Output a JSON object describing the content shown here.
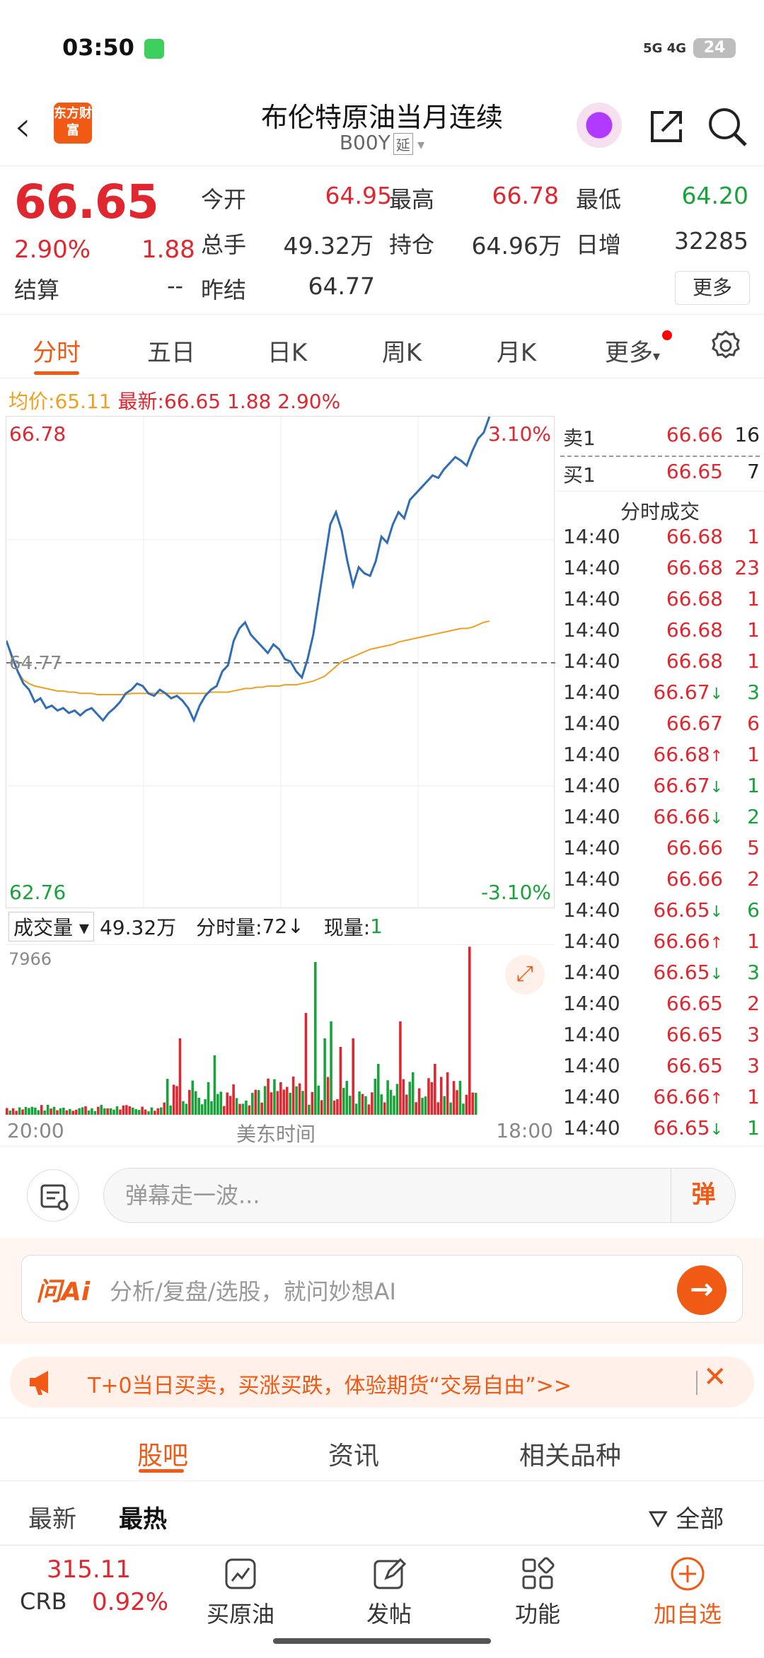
{
  "status": {
    "time": "03:50",
    "signal": "5G 4G",
    "battery": "24"
  },
  "header": {
    "back": "‹",
    "logo_text": "东方财富",
    "title": "布伦特原油当月连续",
    "code": "B00Y",
    "code_tag": "延"
  },
  "quote": {
    "price": "66.65",
    "pct": "2.90%",
    "change": "1.88",
    "settle_label": "结算",
    "settle_value": "--",
    "open_label": "今开",
    "open_value": "64.95",
    "high_label": "最高",
    "high_value": "66.78",
    "low_label": "最低",
    "low_value": "64.20",
    "vol_label": "总手",
    "vol_value": "49.32万",
    "oi_label": "持仓",
    "oi_value": "64.96万",
    "inc_label": "日增",
    "inc_value": "32285",
    "prev_label": "昨结",
    "prev_value": "64.77",
    "more": "更多"
  },
  "tabs": [
    "分时",
    "五日",
    "日K",
    "周K",
    "月K",
    "更多"
  ],
  "avg_line": {
    "avg_label": "均价:",
    "avg_value": "65.11",
    "last_label": "最新:",
    "last_value": "66.65",
    "chg": "1.88",
    "pct": "2.90%"
  },
  "chart_data": {
    "type": "line",
    "title": "",
    "ylim": [
      62.76,
      66.78
    ],
    "ref": 64.77,
    "y_top_label": "66.78",
    "y_bottom_label": "62.76",
    "pct_top": "3.10%",
    "pct_bottom": "-3.10%",
    "ref_label": "64.77",
    "x_start": "20:00",
    "x_mid": "美东时间",
    "x_end": "18:00",
    "price_series": [
      64.95,
      64.82,
      64.7,
      64.6,
      64.55,
      64.45,
      64.48,
      64.4,
      64.42,
      64.38,
      64.4,
      64.36,
      64.38,
      64.34,
      64.38,
      64.4,
      64.35,
      64.3,
      64.36,
      64.4,
      64.45,
      64.52,
      64.55,
      64.6,
      64.58,
      64.52,
      64.5,
      64.55,
      64.52,
      64.48,
      64.5,
      64.46,
      64.4,
      64.3,
      64.42,
      64.5,
      64.55,
      64.58,
      64.7,
      64.75,
      64.95,
      65.05,
      65.1,
      65.0,
      64.95,
      64.9,
      64.85,
      64.92,
      64.88,
      64.8,
      64.78,
      64.7,
      64.65,
      64.8,
      65.0,
      65.3,
      65.6,
      65.9,
      66.0,
      65.85,
      65.6,
      65.4,
      65.55,
      65.5,
      65.48,
      65.6,
      65.8,
      65.75,
      65.9,
      66.0,
      65.95,
      66.1,
      66.15,
      66.2,
      66.25,
      66.3,
      66.28,
      66.35,
      66.4,
      66.45,
      66.42,
      66.38,
      66.5,
      66.6,
      66.65,
      66.78
    ],
    "avg_series": [
      64.95,
      64.8,
      64.7,
      64.63,
      64.6,
      64.58,
      64.57,
      64.56,
      64.55,
      64.54,
      64.54,
      64.53,
      64.53,
      64.52,
      64.52,
      64.52,
      64.51,
      64.51,
      64.51,
      64.51,
      64.51,
      64.51,
      64.52,
      64.52,
      64.52,
      64.52,
      64.52,
      64.52,
      64.52,
      64.52,
      64.52,
      64.52,
      64.52,
      64.52,
      64.52,
      64.52,
      64.53,
      64.53,
      64.53,
      64.53,
      64.54,
      64.55,
      64.56,
      64.56,
      64.57,
      64.57,
      64.58,
      64.58,
      64.58,
      64.59,
      64.59,
      64.59,
      64.6,
      64.61,
      64.62,
      64.64,
      64.66,
      64.7,
      64.74,
      64.78,
      64.8,
      64.82,
      64.84,
      64.86,
      64.88,
      64.89,
      64.9,
      64.91,
      64.92,
      64.94,
      64.95,
      64.96,
      64.97,
      64.98,
      64.99,
      65.0,
      65.01,
      65.02,
      65.03,
      65.04,
      65.05,
      65.05,
      65.06,
      65.08,
      65.1,
      65.11
    ],
    "volume_max_label": "7966",
    "volume_label": "成交量",
    "volume_total": "49.32万",
    "tick_vol_label": "分时量:",
    "tick_vol": "72",
    "cur_vol_label": "现量:",
    "cur_vol": "1"
  },
  "orderbook": {
    "ask_label": "卖1",
    "ask_price": "66.66",
    "ask_vol": "16",
    "bid_label": "买1",
    "bid_price": "66.65",
    "bid_vol": "7",
    "trades_title": "分时成交",
    "trades": [
      {
        "t": "14:40",
        "p": "66.68",
        "v": "1",
        "d": ""
      },
      {
        "t": "14:40",
        "p": "66.68",
        "v": "23",
        "d": ""
      },
      {
        "t": "14:40",
        "p": "66.68",
        "v": "1",
        "d": ""
      },
      {
        "t": "14:40",
        "p": "66.68",
        "v": "1",
        "d": ""
      },
      {
        "t": "14:40",
        "p": "66.68",
        "v": "1",
        "d": ""
      },
      {
        "t": "14:40",
        "p": "66.67",
        "v": "3",
        "d": "↓"
      },
      {
        "t": "14:40",
        "p": "66.67",
        "v": "6",
        "d": ""
      },
      {
        "t": "14:40",
        "p": "66.68",
        "v": "1",
        "d": "↑"
      },
      {
        "t": "14:40",
        "p": "66.67",
        "v": "1",
        "d": "↓"
      },
      {
        "t": "14:40",
        "p": "66.66",
        "v": "2",
        "d": "↓"
      },
      {
        "t": "14:40",
        "p": "66.66",
        "v": "5",
        "d": ""
      },
      {
        "t": "14:40",
        "p": "66.66",
        "v": "2",
        "d": ""
      },
      {
        "t": "14:40",
        "p": "66.65",
        "v": "6",
        "d": "↓"
      },
      {
        "t": "14:40",
        "p": "66.66",
        "v": "1",
        "d": "↑"
      },
      {
        "t": "14:40",
        "p": "66.65",
        "v": "3",
        "d": "↓"
      },
      {
        "t": "14:40",
        "p": "66.65",
        "v": "2",
        "d": ""
      },
      {
        "t": "14:40",
        "p": "66.65",
        "v": "3",
        "d": ""
      },
      {
        "t": "14:40",
        "p": "66.65",
        "v": "3",
        "d": ""
      },
      {
        "t": "14:40",
        "p": "66.66",
        "v": "1",
        "d": "↑"
      },
      {
        "t": "14:40",
        "p": "66.65",
        "v": "1",
        "d": "↓"
      }
    ]
  },
  "danmu": {
    "placeholder": "弹幕走一波...",
    "btn": "弹"
  },
  "ai": {
    "logo": "问Ai",
    "placeholder": "分析/复盘/选股，就问妙想AI",
    "go": "→"
  },
  "promo": {
    "text": "T+0当日买卖，买涨买跌，体验期货“交易自由”>>",
    "close": "✕"
  },
  "section_tabs": [
    "股吧",
    "资讯",
    "相关品种"
  ],
  "sort": {
    "latest": "最新",
    "hot": "最热",
    "filter": "全部"
  },
  "bottom": {
    "ticker_value": "315.11",
    "ticker_name": "CRB",
    "ticker_pct": "0.92%",
    "buy": "买原油",
    "post": "发帖",
    "func": "功能",
    "add": "加自选"
  },
  "colors": {
    "up": "#e0262f",
    "down": "#17a33a",
    "accent": "#f05a14",
    "line": "#2f6db5",
    "avg": "#f0a020"
  }
}
